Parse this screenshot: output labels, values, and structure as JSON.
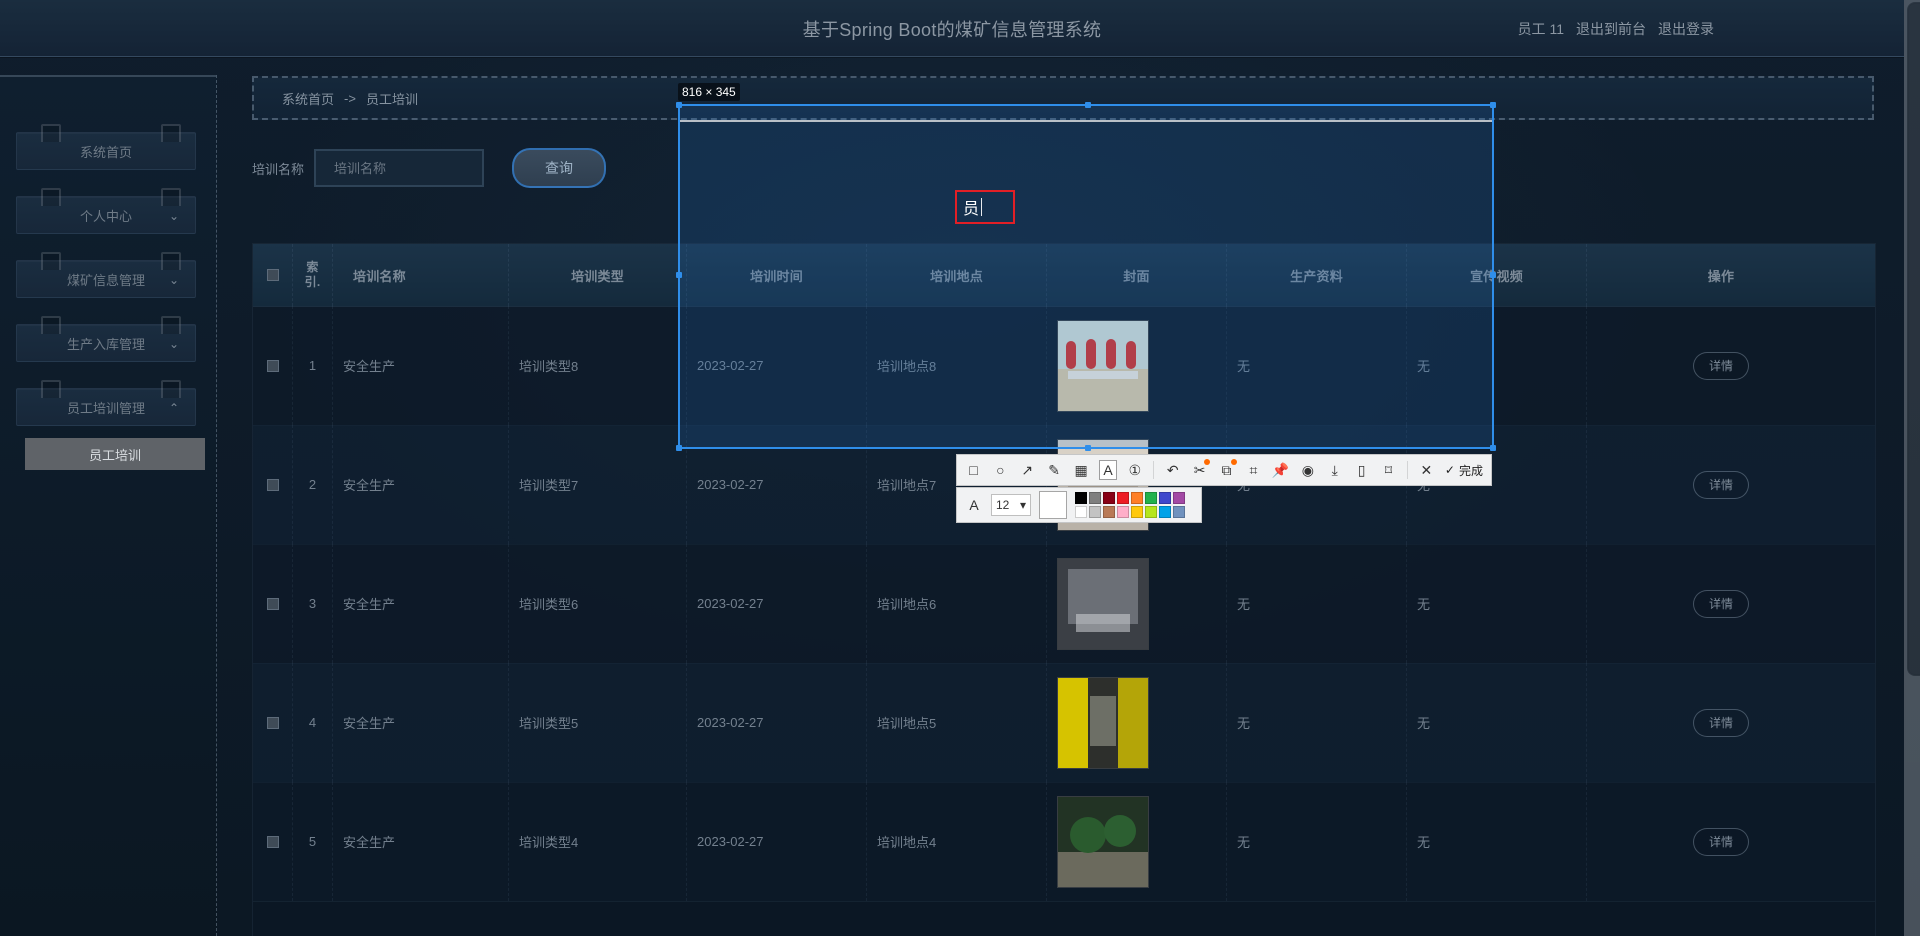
{
  "topbar": {
    "title": "基于Spring Boot的煤矿信息管理系统",
    "user_label": "员工 11",
    "to_frontend": "退出到前台",
    "logout": "退出登录"
  },
  "sidebar": {
    "items": [
      {
        "label": "系统首页"
      },
      {
        "label": "个人中心",
        "chevron": "⌄"
      },
      {
        "label": "煤矿信息管理",
        "chevron": "⌄"
      },
      {
        "label": "生产入库管理",
        "chevron": "⌄"
      },
      {
        "label": "员工培训管理",
        "chevron": "⌃"
      }
    ],
    "active_sub": "员工培训"
  },
  "breadcrumb": {
    "home": "系统首页",
    "sep": "->",
    "current": "员工培训"
  },
  "filter": {
    "label": "培训名称",
    "placeholder": "培训名称",
    "search_button": "查询"
  },
  "table": {
    "headers": {
      "index": [
        "索",
        "引."
      ],
      "name": "培训名称",
      "type": "培训类型",
      "time": "培训时间",
      "location": "培训地点",
      "cover": "封面",
      "materials": "生产资料",
      "video": "宣传视频",
      "actions": "操作"
    },
    "rows": [
      {
        "idx": "1",
        "name": "安全生产",
        "type": "培训类型8",
        "time": "2023-02-27",
        "location": "培训地点8",
        "materials": "无",
        "video": "无",
        "action": "详情"
      },
      {
        "idx": "2",
        "name": "安全生产",
        "type": "培训类型7",
        "time": "2023-02-27",
        "location": "培训地点7",
        "materials": "无",
        "video": "无",
        "action": "详情"
      },
      {
        "idx": "3",
        "name": "安全生产",
        "type": "培训类型6",
        "time": "2023-02-27",
        "location": "培训地点6",
        "materials": "无",
        "video": "无",
        "action": "详情"
      },
      {
        "idx": "4",
        "name": "安全生产",
        "type": "培训类型5",
        "time": "2023-02-27",
        "location": "培训地点5",
        "materials": "无",
        "video": "无",
        "action": "详情"
      },
      {
        "idx": "5",
        "name": "安全生产",
        "type": "培训类型4",
        "time": "2023-02-27",
        "location": "培训地点4",
        "materials": "无",
        "video": "无",
        "action": "详情"
      }
    ]
  },
  "overlay": {
    "selection_size": "816 × 345",
    "text_box_value": "员",
    "toolbar": {
      "done_label": "完成"
    },
    "text_tool": {
      "font_size": "12",
      "selected_color": "#ffffff",
      "palette": [
        "#000000",
        "#7f7f7f",
        "#880015",
        "#ed1c24",
        "#ff7f27",
        "#22b14c",
        "#3f48cc",
        "#a349a4",
        "#ffffff",
        "#c3c3c3",
        "#b97a57",
        "#ffaec9",
        "#ffc90e",
        "#b5e61d",
        "#00a2e8",
        "#7092be"
      ]
    }
  }
}
